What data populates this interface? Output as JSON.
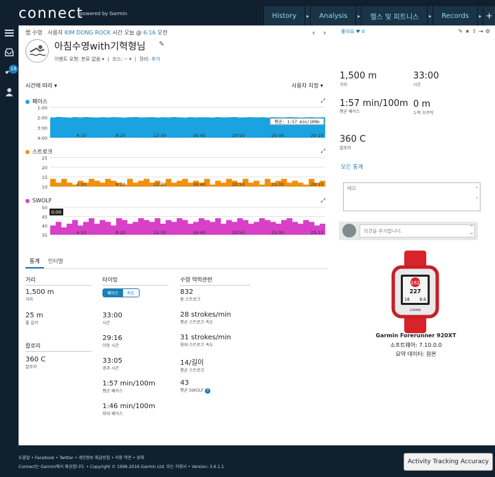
{
  "brand": {
    "logo": "connect",
    "sub": "powered by Garmin"
  },
  "nav": {
    "tabs": [
      "History",
      "Analysis",
      "헬스 및 피트니스",
      "Records"
    ],
    "plus": "+"
  },
  "sidebar": {
    "badge": "19"
  },
  "activity": {
    "type": "랩 수영",
    "by_label": "사용자",
    "user": "KIM DONG ROCK",
    "time_prefix": "시간 오늘 @",
    "time": "6:16",
    "time_suffix": "오전",
    "title": "아침수영with기혁형님",
    "event_type_label": "이벤트 유형:",
    "event_type": "분류 없음",
    "course_label": "코스:",
    "course": "--",
    "gear_label": "장비:",
    "gear": "추가"
  },
  "chart_controls": {
    "time_select": "시간에 따라",
    "user_select": "사용자 지정"
  },
  "chart_data": [
    {
      "type": "bar",
      "title": "페이스",
      "color": "#1aa3e0",
      "y_ticks": [
        "1:00",
        "2:00",
        "3:00",
        "4:00"
      ],
      "ylim": [
        1.0,
        4.0
      ],
      "y_reversed": true,
      "x_ticks": [
        "4:10",
        "8:20",
        "12:30",
        "16:40",
        "20:50",
        "25:00",
        "29:10"
      ],
      "avg_label": "평균: 1:57 min/100m",
      "values": [
        2.0,
        1.95,
        1.98,
        2.02,
        1.97,
        2.0,
        1.96,
        1.99,
        2.01,
        1.98,
        2.0,
        1.97,
        1.99,
        2.02,
        1.98,
        1.96,
        2.0,
        1.99,
        1.97,
        2.01,
        1.98,
        2.0,
        1.96,
        1.99,
        2.02,
        1.97,
        2.0,
        1.98,
        1.99,
        2.01,
        1.97,
        2.0,
        1.98,
        1.96,
        2.01,
        1.99,
        1.97,
        2.0,
        1.98,
        2.02,
        1.97,
        1.99,
        2.0,
        1.96,
        1.98,
        2.01,
        1.99,
        1.97,
        2.0,
        1.98
      ]
    },
    {
      "type": "bar",
      "title": "스트로크",
      "color": "#f0900c",
      "y_ticks": [
        "25",
        "20",
        "15",
        "10"
      ],
      "ylim": [
        10,
        25
      ],
      "x_ticks": [
        "4:10",
        "8:20",
        "12:30",
        "16:40",
        "20:50",
        "25:00",
        "29:10"
      ],
      "values": [
        14,
        12,
        14,
        12,
        11,
        13,
        12,
        14,
        13,
        12,
        14,
        13,
        12,
        11,
        14,
        12,
        13,
        14,
        12,
        13,
        11,
        14,
        12,
        13,
        14,
        12,
        13,
        12,
        14,
        11,
        13,
        12,
        14,
        13,
        12,
        14,
        12,
        13,
        11,
        14,
        12,
        13,
        14,
        12,
        13,
        12,
        11,
        14,
        12,
        13
      ]
    },
    {
      "type": "bar",
      "title": "SWOLF",
      "color": "#d940c8",
      "y_ticks": [
        "50",
        "45",
        "40",
        "35"
      ],
      "ylim": [
        35,
        50
      ],
      "x_ticks": [
        "4:10",
        "8:20",
        "12:30",
        "16:40",
        "20:50",
        "25:00",
        "29:10"
      ],
      "cursor_label": "0:00",
      "values": [
        40,
        42,
        39,
        41,
        43,
        40,
        42,
        44,
        41,
        43,
        42,
        40,
        44,
        43,
        41,
        42,
        44,
        43,
        42,
        44,
        41,
        43,
        42,
        44,
        43,
        41,
        42,
        44,
        43,
        42,
        44,
        41,
        43,
        42,
        44,
        43,
        41,
        42,
        44,
        43,
        42,
        41,
        43,
        44,
        42,
        41,
        43,
        42,
        40,
        41
      ]
    }
  ],
  "stats_tabs": [
    "통계",
    "인터벌"
  ],
  "stats": {
    "distance": {
      "head": "거리",
      "items": [
        {
          "value": "1,500 m",
          "label": "거리"
        },
        {
          "value": "25 m",
          "label": "풀 길이"
        }
      ]
    },
    "calories": {
      "head": "칼로리",
      "items": [
        {
          "value": "360 C",
          "label": "칼로리"
        }
      ]
    },
    "timing": {
      "head": "타이밍",
      "toggle": [
        "페이스",
        "속도"
      ],
      "items": [
        {
          "value": "33:00",
          "label": "시간"
        },
        {
          "value": "29:16",
          "label": "이동 시간"
        },
        {
          "value": "33:05",
          "label": "경과 시간"
        },
        {
          "value": "1:57 min/100m",
          "label": "평균 페이스"
        },
        {
          "value": "1:46 min/100m",
          "label": "최대 페이스"
        }
      ]
    },
    "swim": {
      "head": "수영 역학관련",
      "items": [
        {
          "value": "832",
          "label": "총 스트로크"
        },
        {
          "value": "28 strokes/min",
          "label": "평균 스트로크 속도"
        },
        {
          "value": "31 strokes/min",
          "label": "최대 스트로크 속도"
        },
        {
          "value": "14/길이",
          "label": "평균 스트로크"
        },
        {
          "value": "43",
          "label": "평균 SWOLF"
        }
      ]
    }
  },
  "summary": {
    "like": "좋아요",
    "like_count": "0",
    "items": [
      {
        "value": "1,500 m",
        "label": "거리"
      },
      {
        "value": "33:00",
        "label": "시간"
      },
      {
        "value": "1:57 min/100m",
        "label": "평균 페이스"
      },
      {
        "value": "0 m",
        "label": "누적 오르막"
      },
      {
        "value": "360 C",
        "label": "칼로리"
      }
    ],
    "all_stats": "모든 통계",
    "memo_placeholder": "메모",
    "comment_placeholder": "의견을 추가합니다."
  },
  "device": {
    "name": "Garmin Forerunner 920XT",
    "software": "소프트웨어: 7.10.0.0",
    "data": "요약 데이터: 원본",
    "screen": [
      "182",
      "227",
      "18",
      "8.6"
    ]
  },
  "footer": {
    "links": "도움말 • Facebook • Twitter • 개인정보 취급방침 • 이용 약관 • 상태",
    "copyright": "Connect는 Garmin에서 제공합니다. • Copyright © 1996-2016 Garmin Ltd. 또는 자회사 • Version: 3.6.1.1",
    "accuracy_button": "Activity Tracking Accuracy"
  }
}
